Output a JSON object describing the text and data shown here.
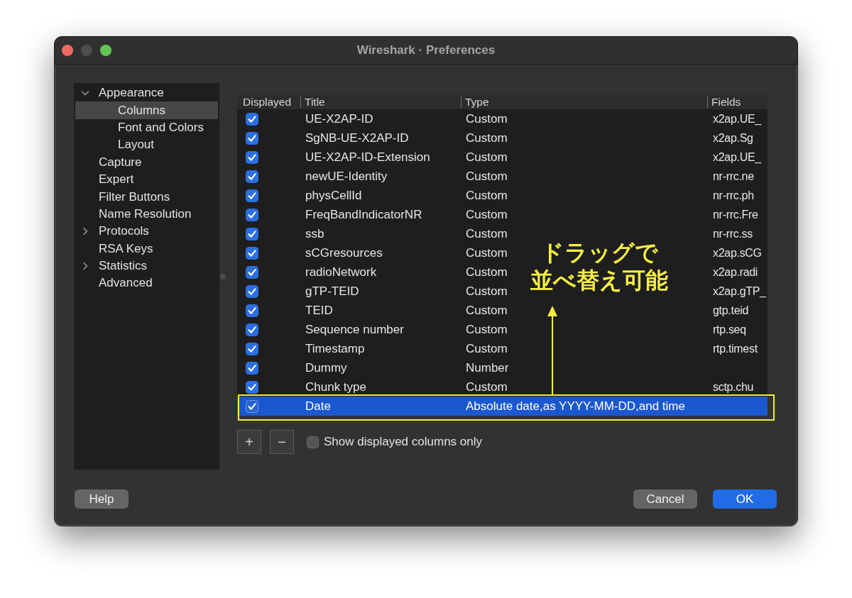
{
  "window": {
    "title": "Wireshark · Preferences",
    "controls": [
      {
        "kind": "close",
        "disabled": false
      },
      {
        "kind": "minimize",
        "disabled": true
      },
      {
        "kind": "zoom",
        "disabled": false
      }
    ]
  },
  "sidebar": {
    "items": [
      {
        "label": "Appearance",
        "kind": "branch",
        "expanded": true,
        "selected": false,
        "children": [
          {
            "label": "Columns",
            "kind": "leaf",
            "selected": true
          },
          {
            "label": "Font and Colors",
            "kind": "leaf",
            "selected": false
          },
          {
            "label": "Layout",
            "kind": "leaf",
            "selected": false
          }
        ]
      },
      {
        "label": "Capture",
        "kind": "leaf",
        "selected": false
      },
      {
        "label": "Expert",
        "kind": "leaf",
        "selected": false
      },
      {
        "label": "Filter Buttons",
        "kind": "leaf",
        "selected": false
      },
      {
        "label": "Name Resolution",
        "kind": "leaf",
        "selected": false
      },
      {
        "label": "Protocols",
        "kind": "branch",
        "expanded": false,
        "selected": false
      },
      {
        "label": "RSA Keys",
        "kind": "leaf",
        "selected": false
      },
      {
        "label": "Statistics",
        "kind": "branch",
        "expanded": false,
        "selected": false
      },
      {
        "label": "Advanced",
        "kind": "leaf",
        "selected": false
      }
    ]
  },
  "columns_table": {
    "headers": [
      "Displayed",
      "Title",
      "Type",
      "Fields"
    ],
    "rows": [
      {
        "displayed": true,
        "title": "UE-X2AP-ID",
        "type": "Custom",
        "fields": "x2ap.UE_",
        "selected": false,
        "outlined": false
      },
      {
        "displayed": true,
        "title": "SgNB-UE-X2AP-ID",
        "type": "Custom",
        "fields": "x2ap.Sg",
        "selected": false,
        "outlined": false
      },
      {
        "displayed": true,
        "title": "UE-X2AP-ID-Extension",
        "type": "Custom",
        "fields": "x2ap.UE_",
        "selected": false,
        "outlined": false
      },
      {
        "displayed": true,
        "title": "newUE-Identity",
        "type": "Custom",
        "fields": "nr-rrc.ne",
        "selected": false,
        "outlined": false
      },
      {
        "displayed": true,
        "title": "physCellId",
        "type": "Custom",
        "fields": "nr-rrc.ph",
        "selected": false,
        "outlined": false
      },
      {
        "displayed": true,
        "title": "FreqBandIndicatorNR",
        "type": "Custom",
        "fields": "nr-rrc.Fre",
        "selected": false,
        "outlined": false
      },
      {
        "displayed": true,
        "title": "ssb",
        "type": "Custom",
        "fields": "nr-rrc.ss",
        "selected": false,
        "outlined": false
      },
      {
        "displayed": true,
        "title": "sCGresources",
        "type": "Custom",
        "fields": "x2ap.sCG",
        "selected": false,
        "outlined": false
      },
      {
        "displayed": true,
        "title": "radioNetwork",
        "type": "Custom",
        "fields": "x2ap.radi",
        "selected": false,
        "outlined": false
      },
      {
        "displayed": true,
        "title": "gTP-TEID",
        "type": "Custom",
        "fields": "x2ap.gTP_",
        "selected": false,
        "outlined": false
      },
      {
        "displayed": true,
        "title": "TEID",
        "type": "Custom",
        "fields": "gtp.teid",
        "selected": false,
        "outlined": false
      },
      {
        "displayed": true,
        "title": "Sequence number",
        "type": "Custom",
        "fields": "rtp.seq",
        "selected": false,
        "outlined": false
      },
      {
        "displayed": true,
        "title": "Timestamp",
        "type": "Custom",
        "fields": "rtp.timest",
        "selected": false,
        "outlined": false
      },
      {
        "displayed": true,
        "title": "Dummy",
        "type": "Number",
        "selected": false,
        "outlined": false
      },
      {
        "displayed": true,
        "title": "Chunk type",
        "type": "Custom",
        "fields": "sctp.chu",
        "selected": false,
        "outlined": false
      },
      {
        "displayed": true,
        "title": "Date",
        "type": "Absolute date,as YYYY-MM-DD,and time",
        "selected": true,
        "outlined": true
      }
    ]
  },
  "annotation": {
    "lines": [
      "ドラッグで",
      "並べ替え可能"
    ]
  },
  "list_buttons": [
    "+",
    "−"
  ],
  "show_displayed_only": {
    "label": "Show displayed columns only",
    "checked": false
  },
  "help_button": "Help",
  "buttons": [
    {
      "label": "Cancel",
      "default": false
    },
    {
      "label": "OK",
      "default": true
    }
  ]
}
